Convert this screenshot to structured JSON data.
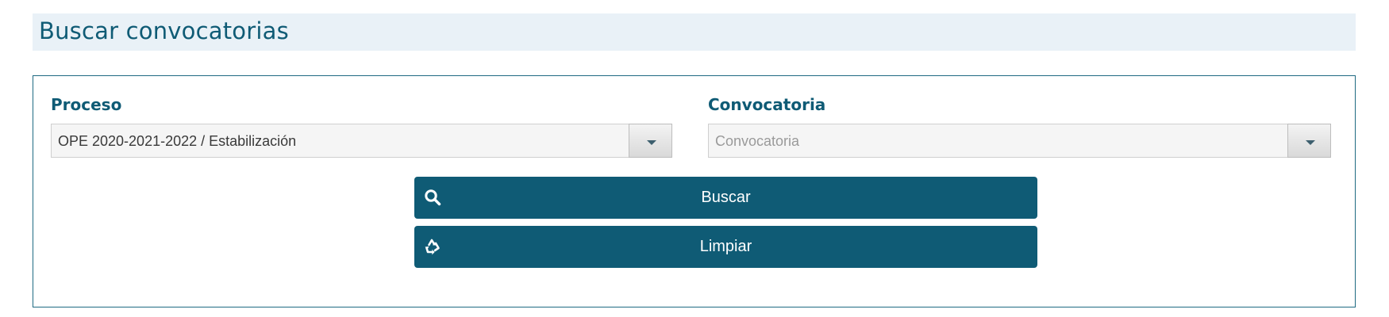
{
  "header": {
    "title": "Buscar convocatorias"
  },
  "form": {
    "proceso": {
      "label": "Proceso",
      "selected_value": "OPE 2020-2021-2022 / Estabilización"
    },
    "convocatoria": {
      "label": "Convocatoria",
      "placeholder": "Convocatoria"
    }
  },
  "actions": {
    "search_label": "Buscar",
    "search_icon": "search-icon",
    "clear_label": "Limpiar",
    "clear_icon": "recycle-icon"
  },
  "colors": {
    "accent": "#0f5b75",
    "title_bg": "#e9f1f7",
    "select_bg": "#f5f5f5"
  }
}
